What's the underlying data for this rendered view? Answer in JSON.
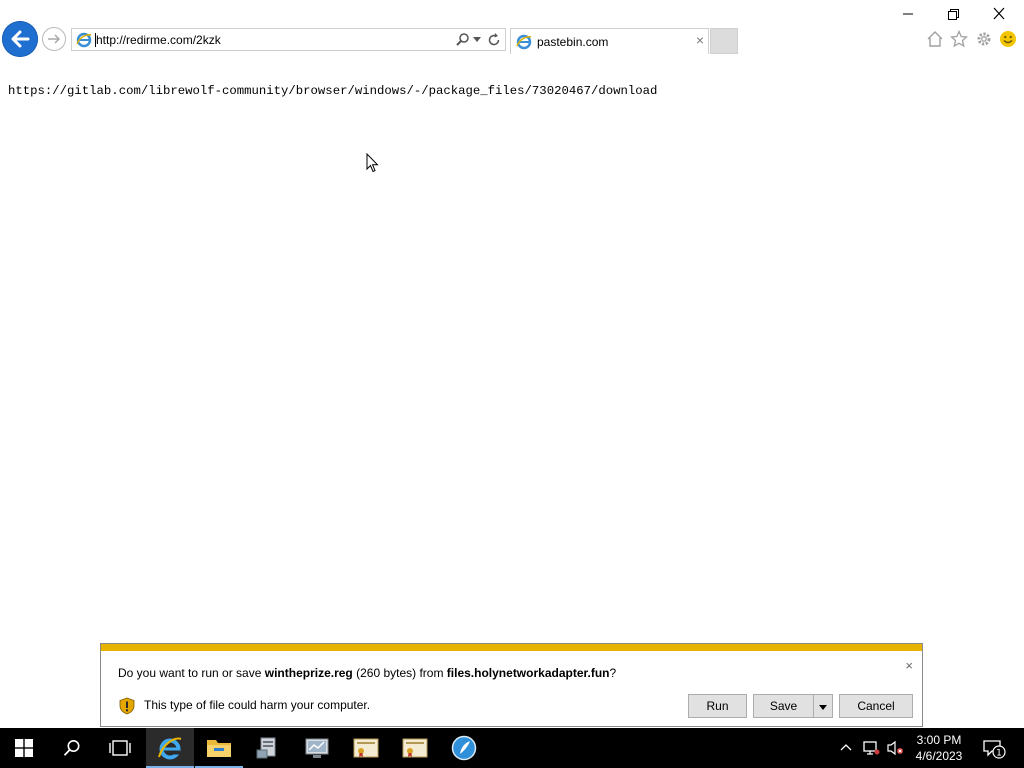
{
  "browser": {
    "address_url": "http://redirme.com/2kzk",
    "tab_title": "pastebin.com",
    "tab_close": "×"
  },
  "page": {
    "text": "https://gitlab.com/librewolf-community/browser/windows/-/package_files/73020467/download"
  },
  "download_bar": {
    "question_prefix": "Do you want to run or save ",
    "file_name": "wintheprize.reg",
    "file_size": " (260 bytes) from ",
    "source": "files.holynetworkadapter.fun",
    "question_suffix": "?",
    "warning": "This type of file could harm your computer.",
    "run_label": "Run",
    "save_label": "Save",
    "cancel_label": "Cancel",
    "close": "×"
  },
  "taskbar": {
    "time": "3:00 PM",
    "date": "4/6/2023"
  },
  "colors": {
    "accent": "#1f6fd1",
    "warning_stripe": "#e6b400",
    "taskbar": "#000000"
  },
  "icons": [
    "back-arrow-icon",
    "forward-arrow-icon",
    "ie-page-icon",
    "search-icon",
    "dropdown-icon",
    "refresh-icon",
    "home-icon",
    "favorites-star-icon",
    "settings-gear-icon",
    "smiley-feedback-icon",
    "shield-warning-icon",
    "windows-start-icon",
    "search-taskbar-icon",
    "task-view-icon",
    "internet-explorer-icon",
    "file-explorer-icon",
    "server-manager-icon",
    "network-icon",
    "certificate-icon",
    "certificate-icon-2",
    "browser-app-icon",
    "chevron-up-icon",
    "network-tray-icon",
    "volume-muted-icon",
    "notification-icon"
  ]
}
